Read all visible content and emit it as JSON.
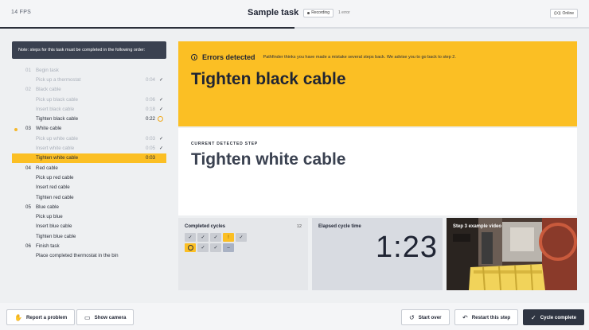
{
  "header": {
    "fps": "14 FPS",
    "title": "Sample task",
    "recording_label": "Recording",
    "error_count": "1 error",
    "status_label": "Online",
    "progress": 0.5
  },
  "sidebar": {
    "note": "Note: steps for this task must be completed in the following order:",
    "steps": [
      {
        "num": "01",
        "label": "Begin task",
        "time": "",
        "check": "",
        "state": "done"
      },
      {
        "num": "",
        "label": "Pick up a thermostat",
        "time": "0:04",
        "check": "✓",
        "state": "done"
      },
      {
        "num": "02",
        "label": "Black cable",
        "time": "",
        "check": "",
        "state": "done"
      },
      {
        "num": "",
        "label": "Pick up black cable",
        "time": "0:06",
        "check": "✓",
        "state": "done"
      },
      {
        "num": "",
        "label": "Insert black cable",
        "time": "0:18",
        "check": "✓",
        "state": "done"
      },
      {
        "num": "",
        "label": "Tighten black cable",
        "time": "0:22",
        "check": "",
        "state": "error"
      },
      {
        "num": "03",
        "label": "White cable",
        "time": "",
        "check": "",
        "state": "current"
      },
      {
        "num": "",
        "label": "Pick up white cable",
        "time": "0:03",
        "check": "✓",
        "state": "done"
      },
      {
        "num": "",
        "label": "Insert white cable",
        "time": "0:05",
        "check": "✓",
        "state": "done"
      },
      {
        "num": "",
        "label": "Tighten white cable",
        "time": "0:03",
        "check": "",
        "state": "active"
      },
      {
        "num": "04",
        "label": "Red cable",
        "time": "",
        "check": "",
        "state": "pending"
      },
      {
        "num": "",
        "label": "Pick up red cable",
        "time": "",
        "check": "",
        "state": "pending"
      },
      {
        "num": "",
        "label": "Insert red cable",
        "time": "",
        "check": "",
        "state": "pending"
      },
      {
        "num": "",
        "label": "Tighten red cable",
        "time": "",
        "check": "",
        "state": "pending"
      },
      {
        "num": "05",
        "label": "Blue cable",
        "time": "",
        "check": "",
        "state": "pending"
      },
      {
        "num": "",
        "label": "Pick up blue",
        "time": "",
        "check": "",
        "state": "pending"
      },
      {
        "num": "",
        "label": "Insert blue cable",
        "time": "",
        "check": "",
        "state": "pending"
      },
      {
        "num": "",
        "label": "Tighten blue cable",
        "time": "",
        "check": "",
        "state": "pending"
      },
      {
        "num": "06",
        "label": "Finish task",
        "time": "",
        "check": "",
        "state": "pending"
      },
      {
        "num": "",
        "label": "Place completed thermostat in the bin",
        "time": "",
        "check": "",
        "state": "pending"
      }
    ]
  },
  "error_panel": {
    "title": "Errors detected",
    "message": "Pathfinder thinks you have made a mistake several steps back. We advise you to go back to step 2.",
    "step": "Tighten black cable",
    "color": "#fbbf24"
  },
  "current_panel": {
    "label": "CURRENT DETECTED STEP",
    "step": "Tighten white cable"
  },
  "cycles": {
    "title": "Completed cycles",
    "count": "12",
    "cells": [
      {
        "glyph": "✓",
        "kind": "ok"
      },
      {
        "glyph": "✓",
        "kind": "ok"
      },
      {
        "glyph": "✓",
        "kind": "ok"
      },
      {
        "glyph": "!",
        "kind": "warn"
      },
      {
        "glyph": "✓",
        "kind": "ok"
      },
      {
        "glyph": "",
        "kind": "clock"
      },
      {
        "glyph": "✓",
        "kind": "ok"
      },
      {
        "glyph": "✓",
        "kind": "ok"
      },
      {
        "glyph": "–",
        "kind": "live"
      }
    ]
  },
  "elapsed": {
    "title": "Elapsed cycle time",
    "time": "1:23"
  },
  "video": {
    "title": "Step 3 example video"
  },
  "footer": {
    "report_label": "Report a problem",
    "camera_label": "Show camera",
    "start_over_label": "Start over",
    "restart_label": "Restart this step",
    "complete_label": "Cycle complete"
  }
}
